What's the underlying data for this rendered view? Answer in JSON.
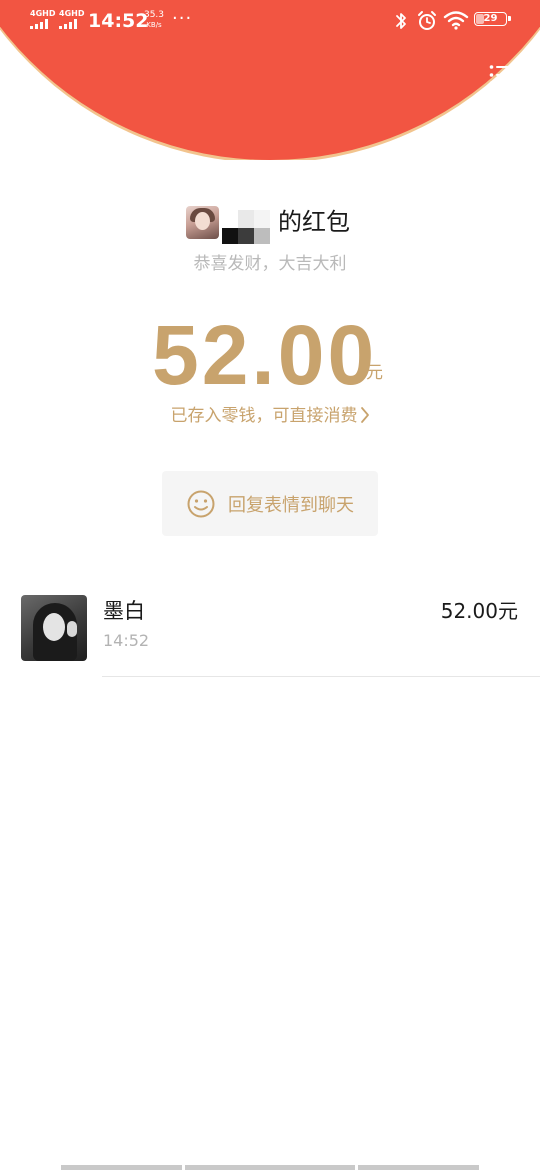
{
  "status_bar": {
    "sim1_label": "4GHD",
    "sim2_label": "4GHD",
    "time": "14:52",
    "net_speed_value": "35.3",
    "net_speed_unit": "KB/s",
    "more_indicator": "···",
    "battery_level": "29",
    "icons": [
      "signal-icon",
      "bluetooth-icon",
      "alarm-icon",
      "wifi-icon",
      "battery-icon"
    ]
  },
  "nav": {
    "back_icon": "chevron-left-icon",
    "menu_icon": "list-menu-icon"
  },
  "red_packet": {
    "sender_name_suffix": "的红包",
    "blessing": "恭喜发财，大吉大利",
    "amount": "52.00",
    "amount_unit": "元",
    "change_link": "已存入零钱，可直接消费",
    "reply_button_label": "回复表情到聊天",
    "reply_icon": "smiley-icon"
  },
  "receivers": [
    {
      "name": "墨白",
      "time": "14:52",
      "amount": "52.00元"
    }
  ],
  "colors": {
    "header_red": "#f25542",
    "gold": "#c8a36d",
    "gray_text": "#b9b9b9"
  }
}
